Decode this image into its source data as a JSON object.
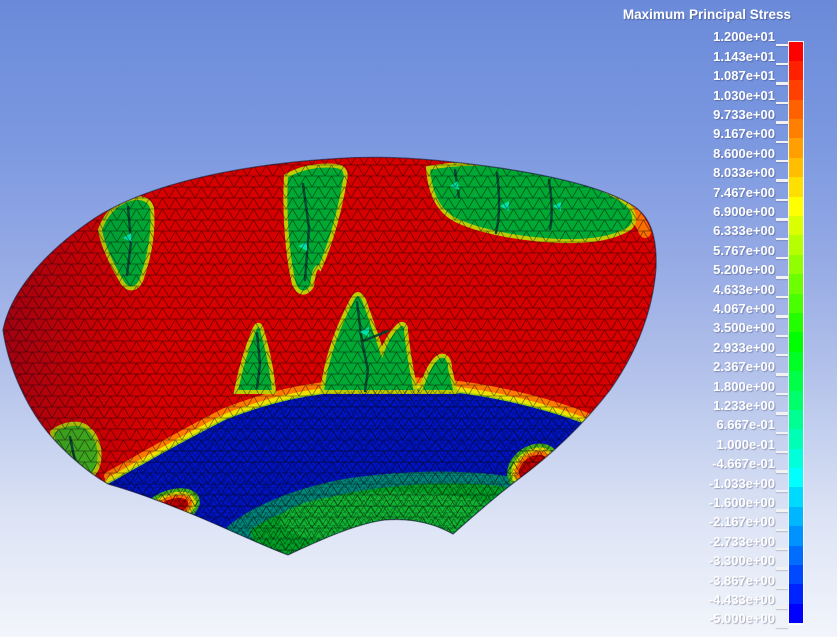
{
  "legend": {
    "title": "Maximum Principal Stress",
    "values": [
      "1.200e+01",
      "1.143e+01",
      "1.087e+01",
      "1.030e+01",
      "9.733e+00",
      "9.167e+00",
      "8.600e+00",
      "8.033e+00",
      "7.467e+00",
      "6.900e+00",
      "6.333e+00",
      "5.767e+00",
      "5.200e+00",
      "4.633e+00",
      "4.067e+00",
      "3.500e+00",
      "2.933e+00",
      "2.367e+00",
      "1.800e+00",
      "1.233e+00",
      "6.667e-01",
      "1.000e-01",
      "-4.667e-01",
      "-1.033e+00",
      "-1.600e+00",
      "-2.167e+00",
      "-2.733e+00",
      "-3.300e+00",
      "-3.867e+00",
      "-4.433e+00",
      "-5.000e+00"
    ],
    "band_colors": [
      "#FF0000",
      "#FF2000",
      "#FF4000",
      "#FF6000",
      "#FF8000",
      "#FF9F00",
      "#FFBF00",
      "#FFDF00",
      "#FFFF00",
      "#DAFF00",
      "#B6FF00",
      "#92FF00",
      "#6DFF00",
      "#49FF00",
      "#24FF00",
      "#00FF00",
      "#00FF24",
      "#00FF49",
      "#00FF6D",
      "#00FF92",
      "#00FFB6",
      "#00FFDA",
      "#00FFFF",
      "#00DAFF",
      "#00B6FF",
      "#0092FF",
      "#006DFF",
      "#0049FF",
      "#0024FF",
      "#0000FF"
    ],
    "text_color": "#FFFFFF"
  },
  "background": {
    "top": "#6A8AD9",
    "bottom": "#F2F5FB"
  },
  "part": {
    "colors": {
      "red_base": "#D60000",
      "blue_band": "#0014C4",
      "teal": "#00857B",
      "green_core": "#00A126",
      "green_bright": "#12B434",
      "feature_green": "#00A834",
      "halo_yellow": "#BFCC00",
      "slot_dark": "#0A4A32",
      "cyan_fleck": "#00E2A8",
      "orange_band": "#FF7A00",
      "yellow_band": "#EFE000",
      "yellowgreen_band": "#8CCC14",
      "blob_red": "#C40000",
      "blob_orange": "#FF7000",
      "blob_yellow": "#DFD800",
      "blob_green": "#44B41A",
      "outline": "#141430"
    }
  },
  "chart_data": {
    "type": "heatmap",
    "title": "Maximum Principal Stress",
    "colormap": "banded rainbow, red = max, blue = min",
    "legend_position": "right",
    "num_bands": 30,
    "scale_max": 12.0,
    "scale_min": -5.0,
    "scale_step": 0.5667,
    "tick_values": [
      12.0,
      11.43,
      10.87,
      10.3,
      9.733,
      9.167,
      8.6,
      8.033,
      7.467,
      6.9,
      6.333,
      5.767,
      5.2,
      4.633,
      4.067,
      3.5,
      2.933,
      2.367,
      1.8,
      1.233,
      0.6667,
      0.1,
      -0.4667,
      -1.033,
      -1.6,
      -2.167,
      -2.733,
      -3.3,
      -3.867,
      -4.433,
      -5.0
    ],
    "plot_description": "Fan-shaped meshed part: large red zone near scale max over the outer region, dark blue band near scale min along the inner radius, teal-to-green zone (~0 to 4) at the inner edge around a semicircular notch, green slotted features (~2 to 7) along the outer arc, and two small red hot spots on the blue band edges."
  }
}
